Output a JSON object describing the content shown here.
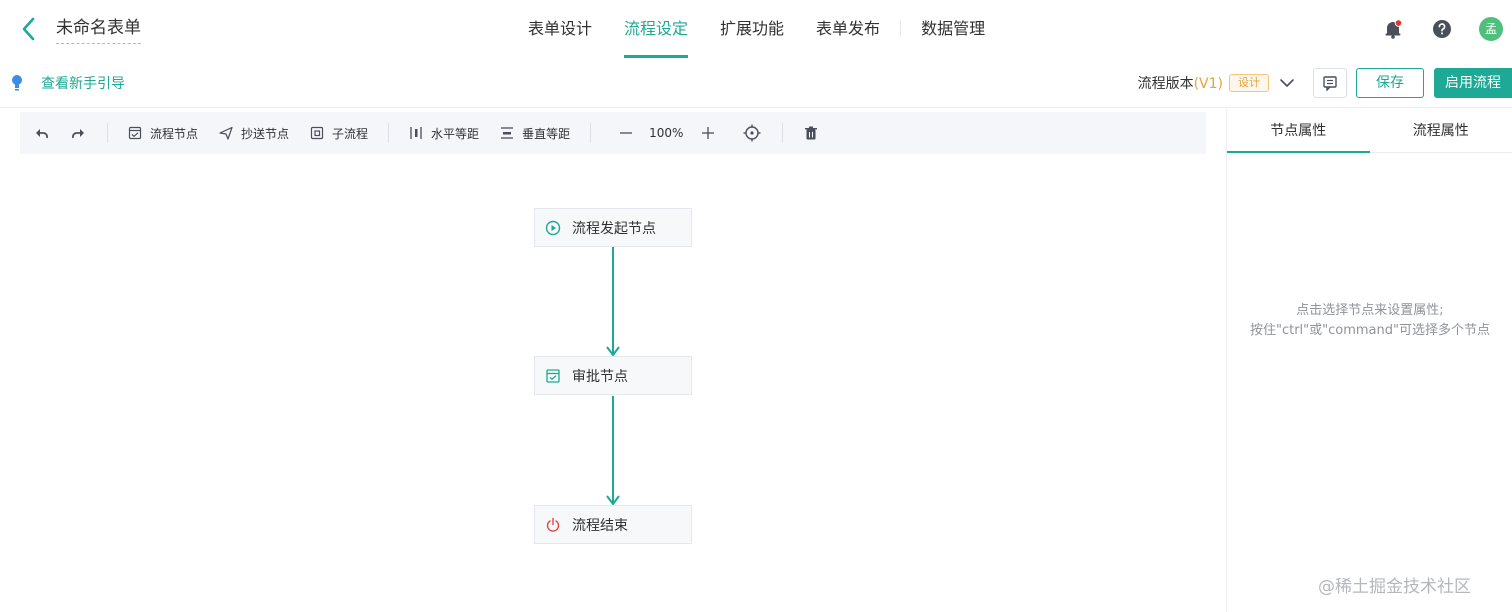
{
  "header": {
    "back_icon": "chevron-left-icon",
    "form_title": "未命名表单",
    "tabs": [
      {
        "label": "表单设计",
        "active": false
      },
      {
        "label": "流程设定",
        "active": true
      },
      {
        "label": "扩展功能",
        "active": false
      },
      {
        "label": "表单发布",
        "active": false
      },
      {
        "label": "数据管理",
        "active": false
      }
    ],
    "avatar_text": "孟",
    "icons": [
      "bell-icon",
      "help-icon",
      "avatar"
    ]
  },
  "subbar": {
    "guide_label": "查看新手引导",
    "version_label": "流程版本",
    "version_value": "(V1)",
    "version_status": "设计",
    "save_label": "保存",
    "enable_label": "启用流程"
  },
  "toolbar": {
    "process_node": "流程节点",
    "cc_node": "抄送节点",
    "sub_process": "子流程",
    "h_spacing": "水平等距",
    "v_spacing": "垂直等距",
    "zoom": "100%"
  },
  "flow": {
    "nodes": [
      {
        "label": "流程发起节点",
        "icon": "play-circle-icon"
      },
      {
        "label": "审批节点",
        "icon": "approve-icon"
      },
      {
        "label": "流程结束",
        "icon": "power-icon"
      }
    ]
  },
  "panel": {
    "tab_node": "节点属性",
    "tab_flow": "流程属性",
    "hint_line1": "点击选择节点来设置属性;",
    "hint_line2": "按住\"ctrl\"或\"command\"可选择多个节点"
  },
  "watermark": "@稀土掘金技术社区",
  "colors": {
    "accent": "#1ea896",
    "warning": "#e6a23c",
    "end_icon": "#e0463f",
    "avatar_bg": "#4ec07c"
  }
}
